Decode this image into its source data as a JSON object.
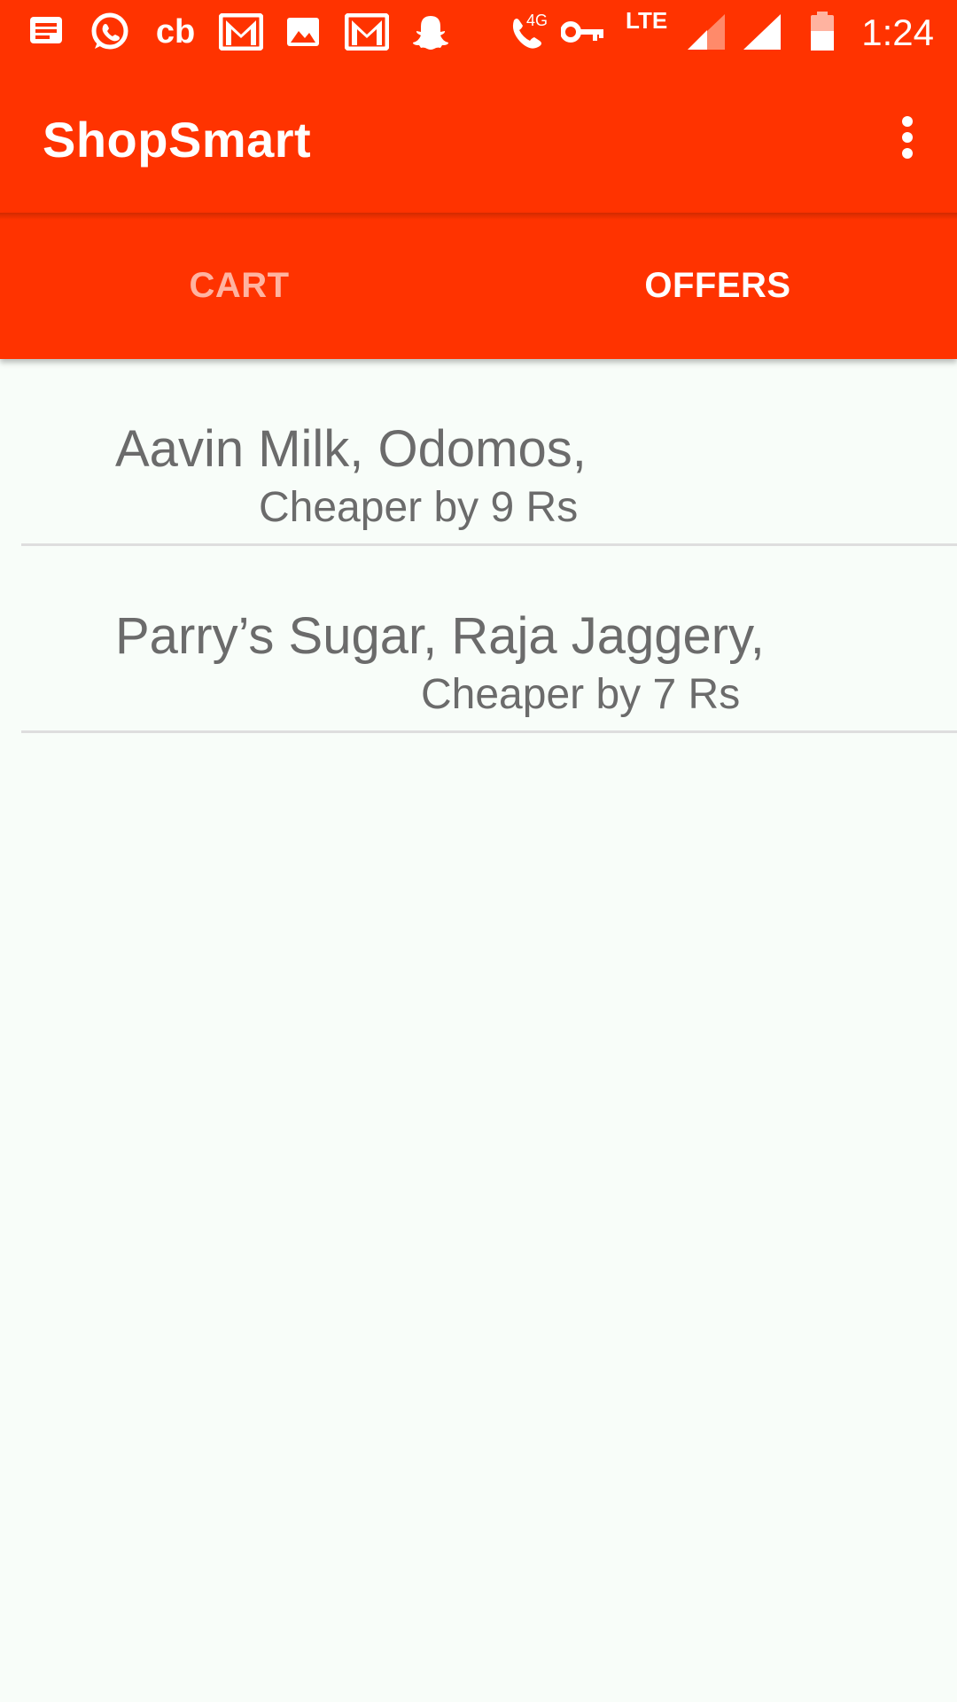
{
  "status_bar": {
    "time": "1:24",
    "network_labels": {
      "call": "4G",
      "lte": "LTE"
    },
    "icons": [
      "message-icon",
      "whatsapp-icon",
      "cb-icon",
      "gmail-icon",
      "gallery-icon",
      "gmail-icon",
      "snapchat-icon",
      "volte-call-icon",
      "vpn-key-icon",
      "signal-icon",
      "signal-icon",
      "battery-icon"
    ],
    "cb_label": "cb"
  },
  "app_bar": {
    "title": "ShopSmart",
    "menu_icon": "overflow-menu-icon"
  },
  "tabs": [
    {
      "label": "CART",
      "active": false
    },
    {
      "label": "OFFERS",
      "active": true
    }
  ],
  "offers": [
    {
      "items": "Aavin Milk, Odomos,",
      "saving": "Cheaper by 9 Rs"
    },
    {
      "items": "Parry’s Sugar, Raja Jaggery,",
      "saving": "Cheaper by 7 Rs"
    }
  ],
  "colors": {
    "primary": "#ff3300",
    "background": "#f8fdf9",
    "text": "#6b6b6b",
    "tab_inactive": "#ffb3a0",
    "divider": "#dedede"
  }
}
